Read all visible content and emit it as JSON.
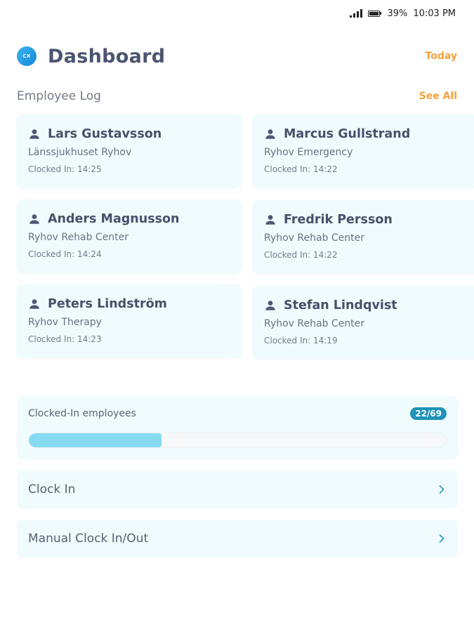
{
  "status_bar": {
    "battery": "39%",
    "time": "10:03 PM",
    "signal_icon": "signal-icon",
    "battery_icon": "battery-icon"
  },
  "header": {
    "logo_text": "CX",
    "title": "Dashboard",
    "today_label": "Today"
  },
  "employee_log": {
    "title": "Employee Log",
    "see_all_label": "See All",
    "person_icon": "person-icon",
    "employees": [
      {
        "name": "Lars Gustavsson",
        "location": "Länssjukhuset Ryhov",
        "clocked_in": "Clocked In: 14:25"
      },
      {
        "name": "Marcus Gullstrand",
        "location": "Ryhov Emergency",
        "clocked_in": "Clocked In: 14:22"
      },
      {
        "name": "Anders Magnusson",
        "location": "Ryhov Rehab Center",
        "clocked_in": "Clocked In: 14:24"
      },
      {
        "name": "Fredrik Persson",
        "location": "Ryhov Rehab Center",
        "clocked_in": "Clocked In: 14:22"
      },
      {
        "name": "Peters Lindström",
        "location": "Ryhov Therapy",
        "clocked_in": "Clocked In: 14:23"
      },
      {
        "name": "Stefan Lindqvist",
        "location": "Ryhov Rehab Center",
        "clocked_in": "Clocked In: 14:19"
      }
    ]
  },
  "clocked_in_summary": {
    "label": "Clocked-In employees",
    "badge": "22/69",
    "progress_fraction": 0.319
  },
  "actions": [
    {
      "label": "Clock In",
      "icon": "chevron-right-icon"
    },
    {
      "label": "Manual Clock In/Out",
      "icon": "chevron-right-icon"
    }
  ],
  "colors": {
    "accent_orange": "#f5a13a",
    "card_bg": "#effbfd",
    "badge_bg": "#1f92b8",
    "progress_fill": "#86dbf1",
    "chevron": "#2a9fc4"
  }
}
